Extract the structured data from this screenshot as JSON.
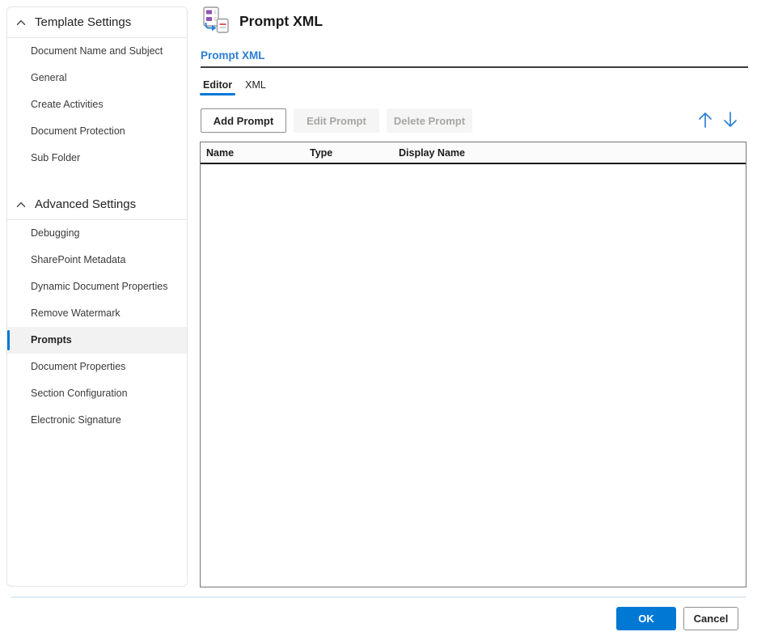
{
  "colors": {
    "accent": "#0078d4",
    "subheading_text": "#2b7cd3",
    "disabled_button_text": "#a8a6a4",
    "selected_item_background": "#f2f2f2"
  },
  "sidebar": {
    "sections": [
      {
        "label": "Template Settings",
        "collapse_icon": "chevron-up",
        "items": [
          {
            "label": "Document Name and Subject",
            "selected": false
          },
          {
            "label": "General",
            "selected": false
          },
          {
            "label": "Create Activities",
            "selected": false
          },
          {
            "label": "Document Protection",
            "selected": false
          },
          {
            "label": "Sub Folder",
            "selected": false
          }
        ]
      },
      {
        "label": "Advanced Settings",
        "collapse_icon": "chevron-up",
        "items": [
          {
            "label": "Debugging",
            "selected": false
          },
          {
            "label": "SharePoint Metadata",
            "selected": false
          },
          {
            "label": "Dynamic Document Properties",
            "selected": false
          },
          {
            "label": "Remove Watermark",
            "selected": false
          },
          {
            "label": "Prompts",
            "selected": true
          },
          {
            "label": "Document Properties",
            "selected": false
          },
          {
            "label": "Section Configuration",
            "selected": false
          },
          {
            "label": "Electronic Signature",
            "selected": false
          }
        ]
      }
    ]
  },
  "header": {
    "title": "Prompt XML",
    "icon": "prompt-xml-icon"
  },
  "section_header": {
    "label": "Prompt XML"
  },
  "tab_strip": {
    "tabs": [
      {
        "label": "Editor",
        "selected": true
      },
      {
        "label": "XML",
        "selected": false
      }
    ]
  },
  "toolbar": {
    "add_label": "Add Prompt",
    "edit_label": "Edit Prompt",
    "delete_label": "Delete Prompt",
    "edit_enabled": false,
    "delete_enabled": false,
    "move_up_icon": "arrow-up",
    "move_down_icon": "arrow-down"
  },
  "prompt_table": {
    "columns": [
      "Name",
      "Type",
      "Display Name"
    ],
    "rows": []
  },
  "footer": {
    "ok_label": "OK",
    "cancel_label": "Cancel"
  }
}
